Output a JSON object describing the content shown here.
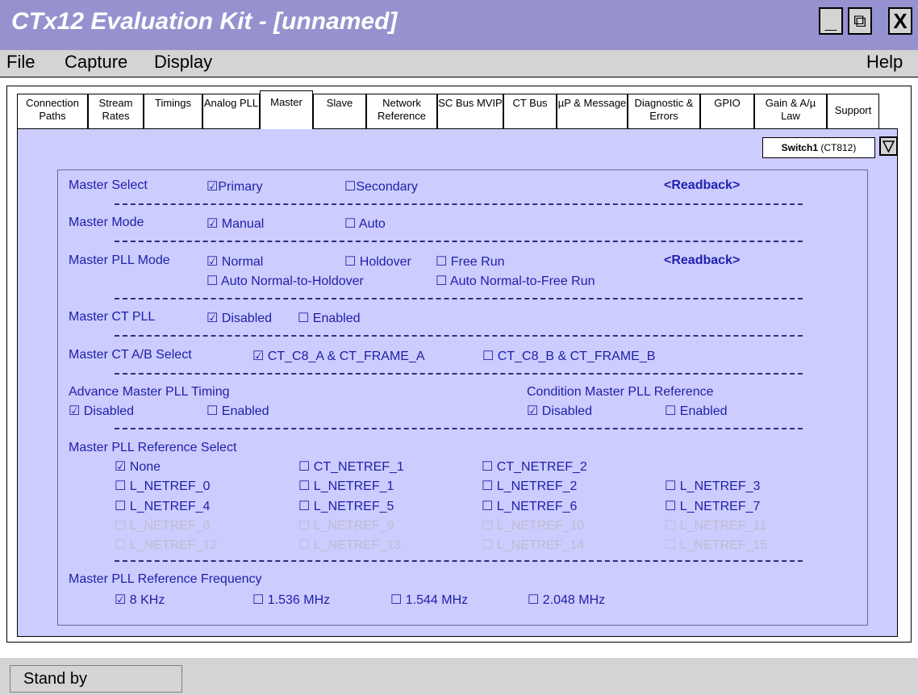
{
  "window": {
    "title": "CTx12 Evaluation Kit - [unnamed]",
    "minimize_glyph": "_",
    "restore_glyph": "⧉",
    "close_glyph": "X"
  },
  "menu": {
    "file": "File",
    "capture": "Capture",
    "display": "Display",
    "help": "Help"
  },
  "tabs": [
    "Connection Paths",
    "Stream Rates",
    "Timings",
    "Analog PLL",
    "Master",
    "Slave",
    "Network Reference",
    "SC Bus MVIP",
    "CT Bus",
    "µP & Message",
    "Diagnostic & Errors",
    "GPIO",
    "Gain & A/µ Law",
    "Support"
  ],
  "active_tab": "Master",
  "switch_select": {
    "name": "Switch1",
    "model": "(CT812)"
  },
  "readback_label": "<Readback>",
  "sections": {
    "master_select": {
      "label": "Master Select",
      "primary": "☑Primary",
      "secondary": "☐Secondary"
    },
    "master_mode": {
      "label": "Master Mode",
      "manual": "☑ Manual",
      "auto": "☐ Auto"
    },
    "master_pll_mode": {
      "label": "Master PLL Mode",
      "normal": "☑ Normal",
      "holdover": "☐ Holdover",
      "free_run": "☐ Free Run",
      "auto_holdover": "☐ Auto Normal-to-Holdover",
      "auto_free_run": "☐ Auto Normal-to-Free Run"
    },
    "master_ct_pll": {
      "label": "Master CT PLL",
      "disabled": "☑ Disabled",
      "enabled": "☐ Enabled"
    },
    "master_ct_ab": {
      "label": "Master CT A/B Select",
      "a": "☑ CT_C8_A & CT_FRAME_A",
      "b": "☐ CT_C8_B & CT_FRAME_B"
    },
    "advance_timing": {
      "label": "Advance Master PLL Timing",
      "disabled": "☑ Disabled",
      "enabled": "☐ Enabled"
    },
    "condition_ref": {
      "label": "Condition Master PLL Reference",
      "disabled": "☑ Disabled",
      "enabled": "☐ Enabled"
    },
    "ref_select": {
      "label": "Master PLL Reference Select",
      "none": "☑ None",
      "ct_netref_1": "☐ CT_NETREF_1",
      "ct_netref_2": "☐ CT_NETREF_2",
      "l_netref": [
        "☐ L_NETREF_0",
        "☐ L_NETREF_1",
        "☐ L_NETREF_2",
        "☐ L_NETREF_3",
        "☐ L_NETREF_4",
        "☐ L_NETREF_5",
        "☐ L_NETREF_6",
        "☐ L_NETREF_7",
        "☐ L_NETREF_8",
        "☐ L_NETREF_9",
        "☐ L_NETREF_10",
        "☐ L_NETREF_11",
        "☐ L_NETREF_12",
        "☐ L_NETREF_13",
        "☐ L_NETREF_14",
        "☐ L_NETREF_15"
      ]
    },
    "ref_freq": {
      "label": "Master PLL Reference Frequency",
      "f8k": "☑ 8 KHz",
      "f1536": "☐ 1.536 MHz",
      "f1544": "☐ 1.544 MHz",
      "f2048": "☐ 2.048 MHz"
    }
  },
  "status": {
    "text": "Stand by"
  },
  "colors": {
    "titlebar": "#9592cf",
    "panel": "#ccccff",
    "text": "#1f1fa8",
    "disabled_text": "#bdbdd0"
  }
}
